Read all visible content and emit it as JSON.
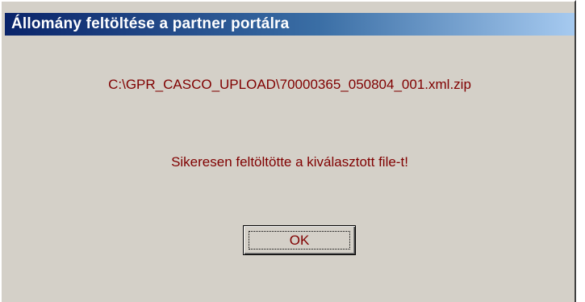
{
  "window": {
    "title": "Állomány feltöltése a partner portálra"
  },
  "content": {
    "file_path": "C:\\GPR_CASCO_UPLOAD\\70000365_050804_001.xml.zip",
    "message": "Sikeresen feltöltötte a kiválasztott file-t!"
  },
  "buttons": {
    "ok_label": "OK"
  },
  "colors": {
    "title_start": "#0a246a",
    "title_end": "#a6caf0",
    "text": "#800000",
    "face": "#d4d0c8"
  }
}
